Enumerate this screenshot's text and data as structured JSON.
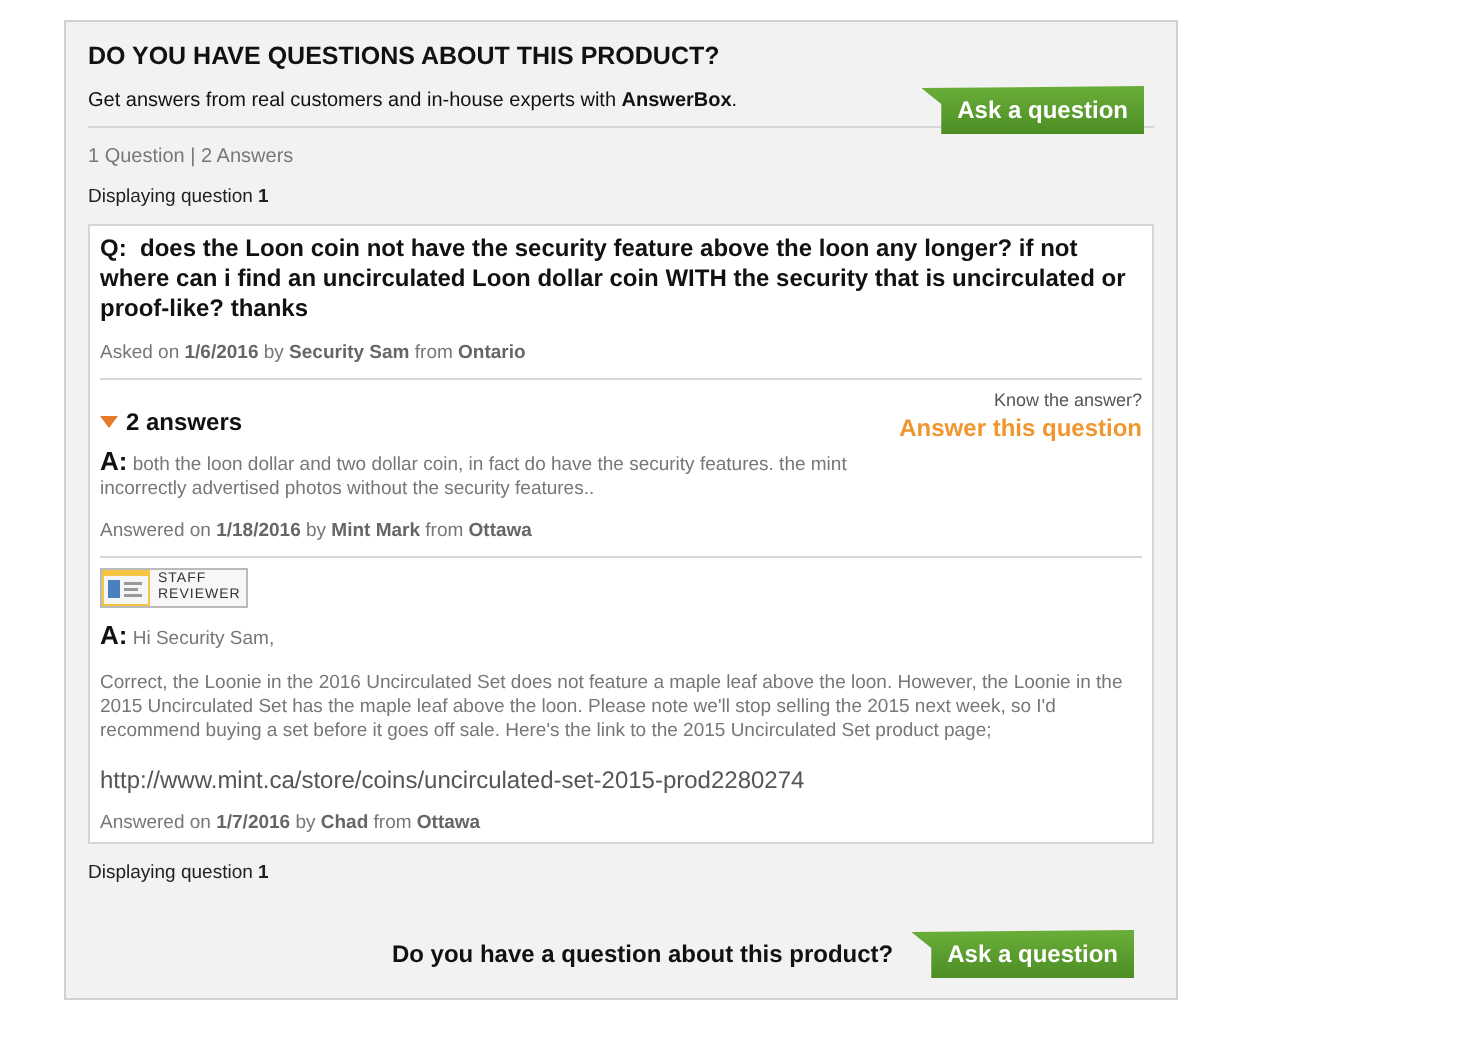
{
  "header": {
    "title": "DO YOU HAVE QUESTIONS ABOUT THIS PRODUCT?",
    "intro": "Get answers from real customers and in-house experts with **AnswerBox**.",
    "ask_button": "Ask a question"
  },
  "counts": "1 Question | 2 Answers",
  "displaying_top": "Displaying question **1**",
  "question": {
    "prefix": "Q:",
    "text": "does the Loon coin not have the security feature above the loon any longer? if not where can i find an uncirculated Loon dollar coin WITH the security that is uncirculated or proof-like? thanks",
    "meta": "Asked on **1/6/2016** by **Security Sam** from **Ontario**"
  },
  "answers_header": {
    "label": "2 answers",
    "expanded": true,
    "prompt": "Know the answer?",
    "answer_link": "Answer this question"
  },
  "answers": [
    {
      "prefix": "A:",
      "text": "both the loon dollar and two dollar coin, in fact do have the security features. the mint incorrectly advertised photos without the security features..",
      "meta": "Answered on **1/18/2016** by **Mint Mark** from **Ottawa**"
    },
    {
      "staff_badge": "STAFF REVIEWER",
      "prefix": "A:",
      "text": "Hi Security Sam,",
      "paragraphs": [
        "Correct, the Loonie in the 2016 Uncirculated Set does not feature a maple leaf above the loon. However, the Loonie in the 2015 Uncirculated Set has the maple leaf above the loon. Please note we'll stop selling the 2015 next week, so I'd recommend buying a set before it goes off sale. Here's the link to the 2015 Uncirculated Set product page;"
      ],
      "link": "http://www.mint.ca/store/coins/uncirculated-set-2015-prod2280274",
      "meta": "Answered on **1/7/2016** by **Chad** from **Ottawa**"
    }
  ],
  "displaying_bottom": "Displaying question **1**",
  "footer": {
    "prompt": "Do you have a question about this product?",
    "ask_button": "Ask a question"
  }
}
